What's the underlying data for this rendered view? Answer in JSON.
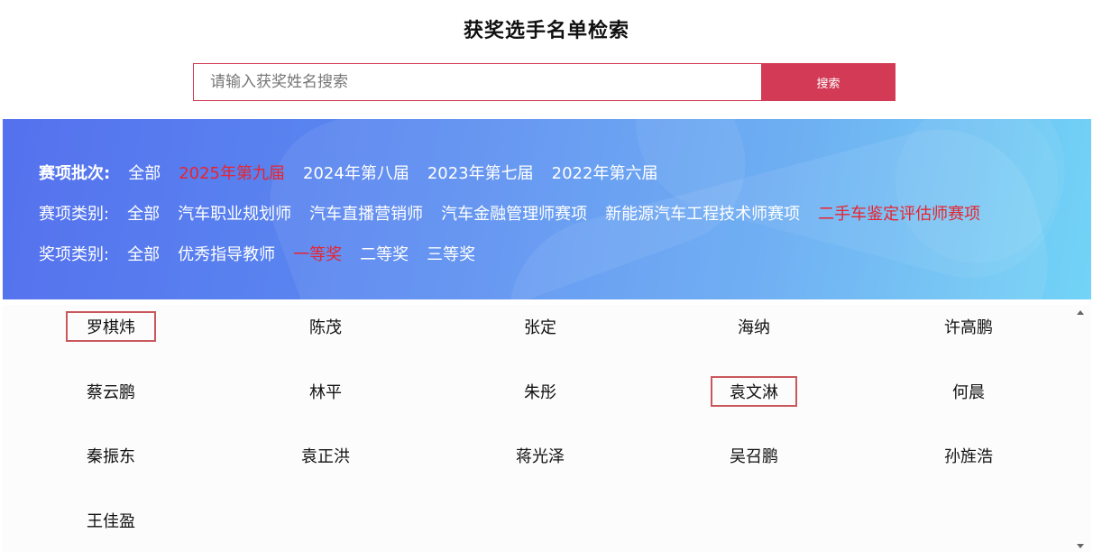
{
  "page": {
    "title": "获奖选手名单检索"
  },
  "search": {
    "placeholder": "请输入获奖姓名搜索",
    "value": "",
    "button_label": "搜索"
  },
  "filters": {
    "batch": {
      "label": "赛项批次:",
      "options": [
        "全部",
        "2025年第九届",
        "2024年第八届",
        "2023年第七届",
        "2022年第六届"
      ],
      "active": "2025年第九届"
    },
    "category": {
      "label": "赛项类别:",
      "options": [
        "全部",
        "汽车职业规划师",
        "汽车直播营销师",
        "汽车金融管理师赛项",
        "新能源汽车工程技术师赛项",
        "二手车鉴定评估师赛项"
      ],
      "active": "二手车鉴定评估师赛项"
    },
    "award": {
      "label": "奖项类别:",
      "options": [
        "全部",
        "优秀指导教师",
        "一等奖",
        "二等奖",
        "三等奖"
      ],
      "active": "一等奖"
    }
  },
  "results": {
    "names": [
      [
        "罗棋炜",
        "陈茂",
        "张定",
        "海纳",
        "许高鹏"
      ],
      [
        "蔡云鹏",
        "林平",
        "朱彤",
        "袁文淋",
        "何晨"
      ],
      [
        "秦振东",
        "袁正洪",
        "蒋光泽",
        "吴召鹏",
        "孙旌浩"
      ],
      [
        "王佳盈"
      ]
    ]
  },
  "colors": {
    "accent": "#d23a55",
    "active_filter": "#e8242f",
    "banner_start": "#5571ee",
    "banner_end": "#73d4f6"
  },
  "icons": [
    "scroll-up-arrow-icon",
    "scroll-down-arrow-icon"
  ]
}
